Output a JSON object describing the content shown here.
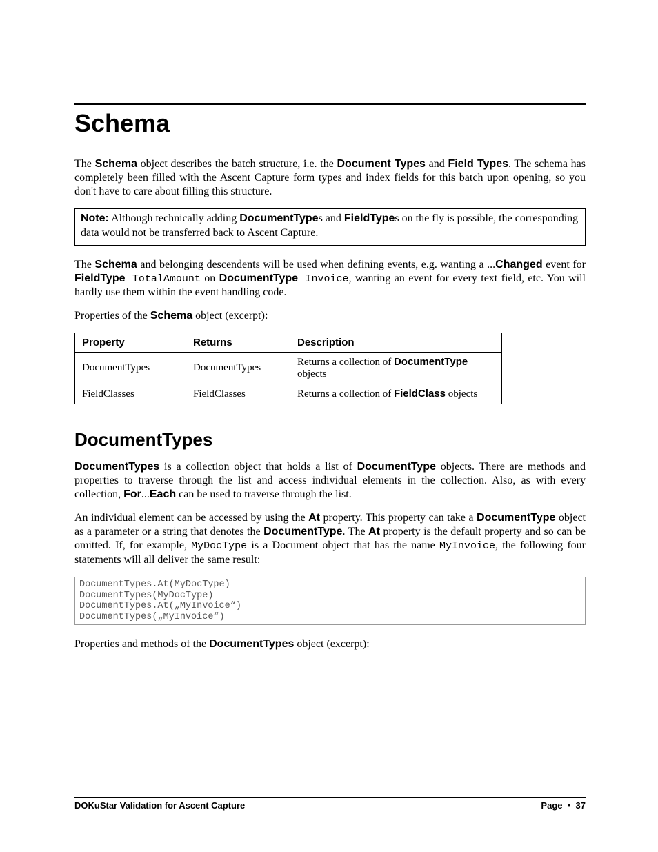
{
  "heading1": "Schema",
  "para1": {
    "t1": "The ",
    "b1": "Schema",
    "t2": " object describes the batch structure, i.e. the ",
    "b2": "Document Types",
    "t3": " and ",
    "b3": "Field Types",
    "t4": ". The schema has completely been filled with the Ascent Capture form types and index fields for this batch upon opening, so you don't have to care about filling this structure."
  },
  "note": {
    "label": "Note:",
    "t1": " Although technically adding ",
    "b1": "DocumentType",
    "t2": "s and ",
    "b2": "FieldType",
    "t3": "s on the fly is possible, the corresponding data would not be transferred back to Ascent Capture."
  },
  "para2": {
    "t1": "The ",
    "b1": "Schema",
    "t2": " and belonging descendents will be used when defining events, e.g. wanting a ...",
    "b2": "Changed",
    "t3": " event for ",
    "b3": "FieldType",
    "m1": " TotalAmount",
    "t4": " on ",
    "b4": "DocumentType",
    "m2": " Invoice",
    "t5": ", wanting an event for every text field, etc. You will hardly use them within the event handling code."
  },
  "para3": {
    "t1": "Properties of the ",
    "b1": "Schema",
    "t2": " object (excerpt):"
  },
  "table1": {
    "headers": [
      "Property",
      "Returns",
      "Description"
    ],
    "rows": [
      {
        "c0": "DocumentTypes",
        "c1": "DocumentTypes",
        "c2_t1": "Returns a collection of ",
        "c2_b1": "DocumentType",
        "c2_t2": " objects"
      },
      {
        "c0": "FieldClasses",
        "c1": "FieldClasses",
        "c2_t1": "Returns a collection of ",
        "c2_b1": "FieldClass",
        "c2_t2": " objects"
      }
    ]
  },
  "heading2": "DocumentTypes",
  "para4": {
    "b1": "DocumentTypes",
    "t1": " is a collection object that holds a list of ",
    "b2": "DocumentType",
    "t2": " objects. There are methods and properties to traverse through the list and access individual elements in the collection. Also, as with every collection, ",
    "b3": "For",
    "t3": "...",
    "b4": "Each",
    "t4": " can be used to traverse through the list."
  },
  "para5": {
    "t1": "An individual element can be accessed by using the ",
    "b1": "At",
    "t2": " property. This property can take a ",
    "b2": "DocumentType",
    "t3": " object as a parameter or a string that denotes the ",
    "b3": "DocumentType",
    "t4": ". The ",
    "b4": "At",
    "t5": " property is the default property and so can be omitted. If, for example, ",
    "m1": "MyDocType",
    "t6": " is a Document object that has the name ",
    "m2": "MyInvoice",
    "t7": ", the following four statements will all deliver the same result:"
  },
  "code1": "DocumentTypes.At(MyDocType)\nDocumentTypes(MyDocType)\nDocumentTypes.At(„MyInvoice“)\nDocumentTypes(„MyInvoice“)",
  "para6": {
    "t1": "Properties and methods of the ",
    "b1": "DocumentTypes",
    "t2": " object (excerpt):"
  },
  "footer": {
    "left": "DOKuStar Validation for Ascent Capture",
    "right_label": "Page",
    "right_bullet": "•",
    "right_num": "37"
  }
}
